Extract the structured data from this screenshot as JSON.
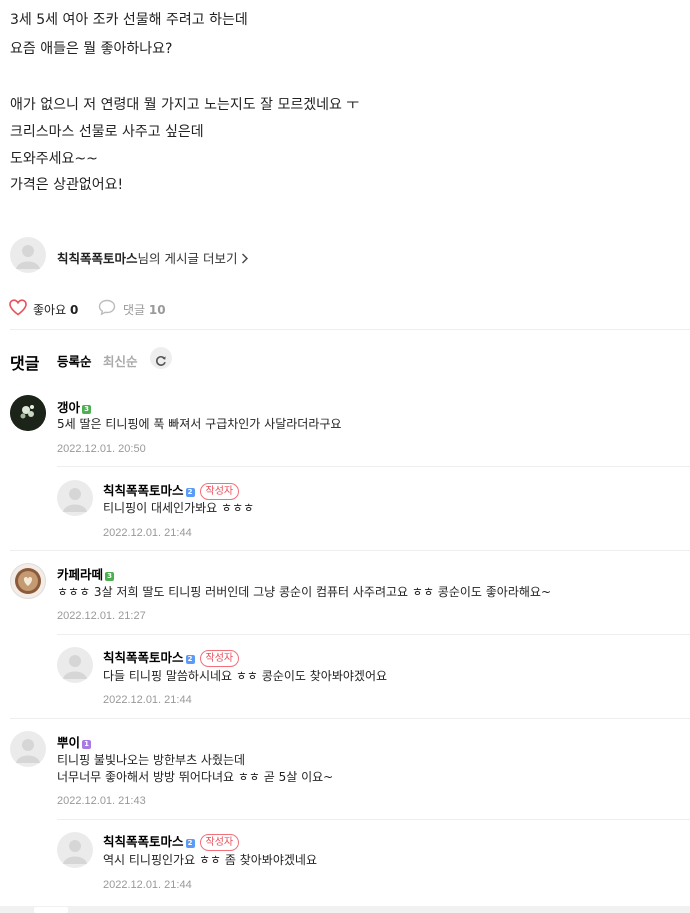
{
  "post": {
    "lines": [
      "3세 5세 여아 조카 선물해 주려고 하는데",
      "요즘 애들은 뭘 좋아하나요?",
      "",
      "애가 없으니 저 연령대 뭘 가지고 노는지도 잘 모르겠네요 ㅜ",
      "크리스마스 선물로 사주고 싶은데",
      "도와주세요~~",
      "가격은 상관없어요!"
    ]
  },
  "author_link": {
    "nickname": "칙칙폭폭토마스",
    "suffix": "님의 게시글 더보기",
    "chevron": ">"
  },
  "reactions": {
    "like_label": "좋아요",
    "like_count": "0",
    "comment_label": "댓글",
    "comment_count": "10"
  },
  "comments_header": {
    "title": "댓글",
    "sort_registered": "등록순",
    "sort_latest": "최신순"
  },
  "author_badge": "작성자",
  "comments": [
    {
      "nick": "갱아",
      "grade": "3",
      "grade_color": "#4caf50",
      "lines": [
        "5세 딸은 티니핑에 푹 빠져서 구급차인가 사달라더라구요"
      ],
      "date": "2022.12.01. 20:50"
    },
    {
      "nick": "칙칙폭폭토마스",
      "grade": "2",
      "grade_color": "#5b9bf5",
      "is_author": true,
      "lines": [
        "티니핑이 대세인가봐요 ㅎㅎㅎ"
      ],
      "date": "2022.12.01. 21:44"
    },
    {
      "nick": "카페라떼",
      "grade": "3",
      "grade_color": "#4caf50",
      "lines": [
        "ㅎㅎㅎ 3살 저희 딸도 티니핑 러버인데 그냥 콩순이 컴퓨터 사주려고요 ㅎㅎ 콩순이도 좋아라해요~"
      ],
      "date": "2022.12.01. 21:27"
    },
    {
      "nick": "칙칙폭폭토마스",
      "grade": "2",
      "grade_color": "#5b9bf5",
      "is_author": true,
      "lines": [
        "다들 티니핑 말씀하시네요 ㅎㅎ 콩순이도 찾아봐야겠어요"
      ],
      "date": "2022.12.01. 21:44"
    },
    {
      "nick": "뿌이",
      "grade": "1",
      "grade_color": "#a979e6",
      "lines": [
        "티니핑 불빛나오는 방한부츠 사줬는데",
        "너무너무 좋아해서 방방 뛰어다녀요 ㅎㅎ 곧 5살 이요~"
      ],
      "date": "2022.12.01. 21:43"
    },
    {
      "nick": "칙칙폭폭토마스",
      "grade": "2",
      "grade_color": "#5b9bf5",
      "is_author": true,
      "lines": [
        "역시 티니핑인가요 ㅎㅎ 좀 찾아봐야겠네요"
      ],
      "date": "2022.12.01. 21:44"
    }
  ],
  "colors": {
    "heart": "#e8505b",
    "author_badge": "#e8505b"
  },
  "icons": {
    "like": "heart-icon",
    "comment": "speech-bubble-icon",
    "refresh": "refresh-icon",
    "chevron": "chevron-right-icon"
  }
}
